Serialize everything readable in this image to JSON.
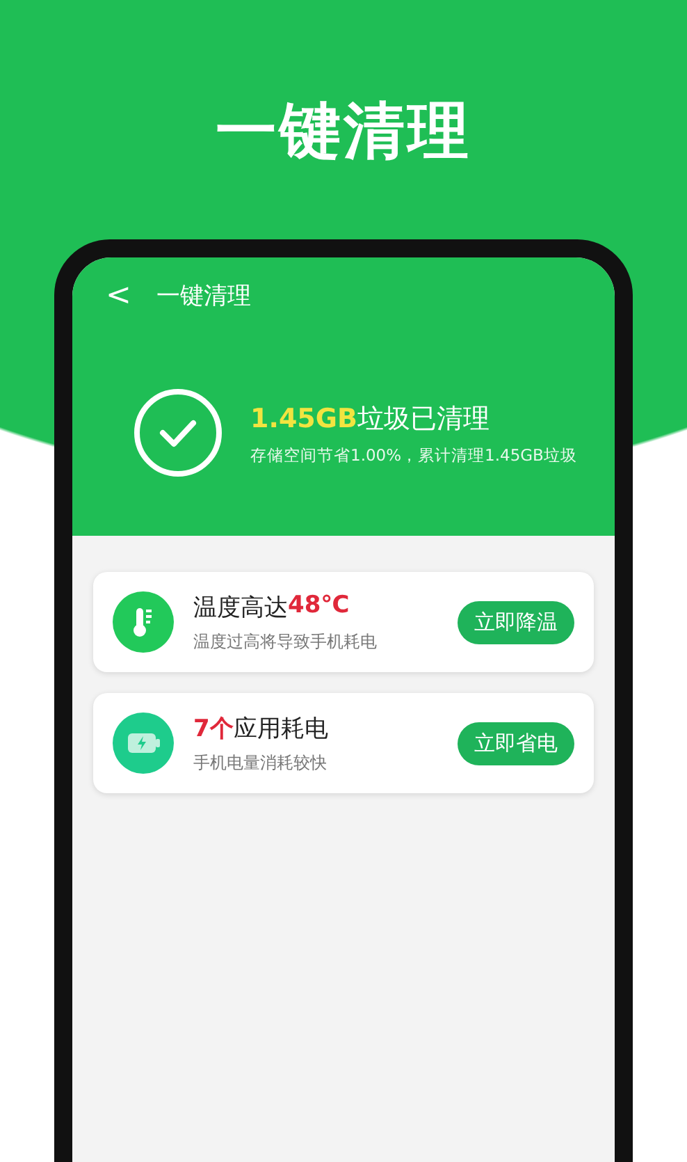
{
  "headline": "一键清理",
  "app": {
    "back": "<",
    "title": "一键清理",
    "result": {
      "amount": "1.45GB",
      "message": "垃圾已清理",
      "detail": "存储空间节省1.00%，累计清理1.45GB垃圾"
    },
    "cards": [
      {
        "kind": "temperature",
        "title": [
          {
            "text": "温度高达",
            "accent": false
          },
          {
            "text": "48℃",
            "accent": true
          }
        ],
        "subtitle": "温度过高将导致手机耗电",
        "action": "立即降温"
      },
      {
        "kind": "battery",
        "title": [
          {
            "text": "7个",
            "accent": true
          },
          {
            "text": "应用耗电",
            "accent": false
          }
        ],
        "subtitle": "手机电量消耗较快",
        "action": "立即省电"
      }
    ]
  }
}
